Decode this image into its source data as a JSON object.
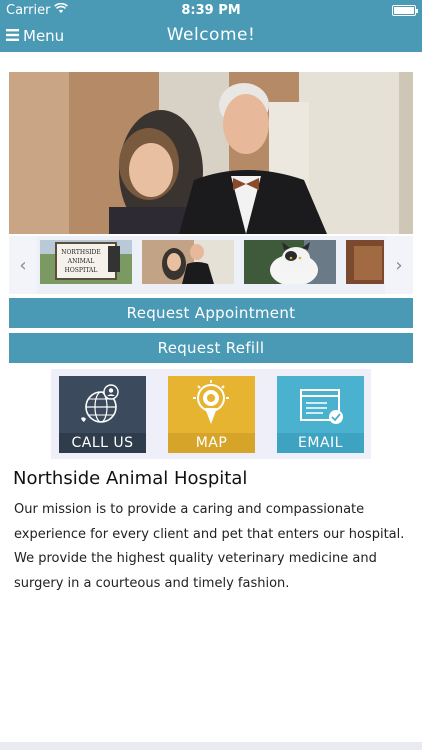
{
  "status_bar": {
    "carrier": "Carrier",
    "time": "8:39 PM"
  },
  "nav": {
    "menu_label": "Menu",
    "title": "Welcome!"
  },
  "thumbnails": {
    "sign_line1": "NORTHSIDE",
    "sign_line2": "ANIMAL",
    "sign_line3": "HOSPITAL"
  },
  "actions": {
    "request_appointment": "Request Appointment",
    "request_refill": "Request Refill"
  },
  "tiles": [
    {
      "label": "CALL US",
      "icon": "globe-phone-icon",
      "color": "#3b4a5c"
    },
    {
      "label": "MAP",
      "icon": "map-pin-icon",
      "color": "#e6b430"
    },
    {
      "label": "EMAIL",
      "icon": "email-window-icon",
      "color": "#4ab2cf"
    }
  ],
  "content": {
    "heading": "Northside Animal Hospital",
    "mission": "Our mission is to provide a caring and compassionate experience for every client and pet that enters our hospital.  We provide the highest quality veterinary medicine and surgery in a courteous and timely fashion."
  },
  "colors": {
    "accent": "#4a9ab5"
  }
}
